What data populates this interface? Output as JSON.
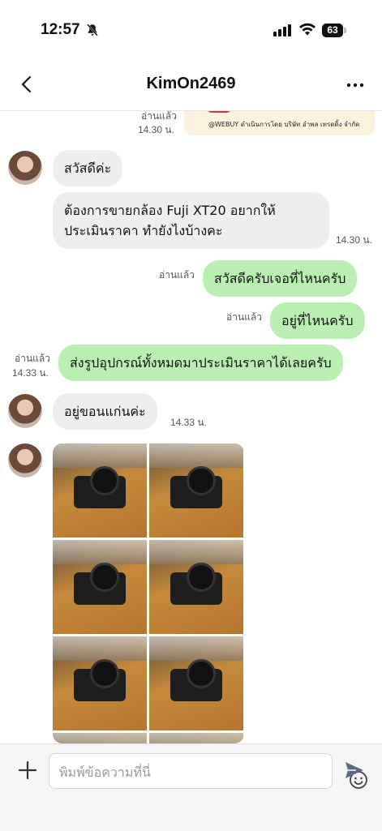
{
  "status_bar": {
    "time": "12:57",
    "battery": "63",
    "bell_icon": "bell-slash-icon",
    "signal_icon": "cellular-signal-icon",
    "wifi_icon": "wifi-icon"
  },
  "header": {
    "title": "KimOn2469",
    "back_icon": "chevron-left-icon",
    "more_icon": "more-horizontal-icon"
  },
  "messages": [
    {
      "kind": "image",
      "direction": "out",
      "read": "อ่านแล้ว",
      "time": "14.30 น.",
      "caption": "@WEBUY ดำเนินการโดย บริษัท อำพล เทรดดิ้ง จำกัด"
    },
    {
      "kind": "text",
      "direction": "in",
      "text": "สวัสดีค่ะ"
    },
    {
      "kind": "text",
      "direction": "in",
      "text_line1": "ต้องการขายกล้อง Fuji XT20 อยากให้",
      "text_line2": "ประเมินราคา ทำยังไงบ้างคะ",
      "time": "14.30 น."
    },
    {
      "kind": "text",
      "direction": "out",
      "read": "อ่านแล้ว",
      "text": "สวัสดีครับเจอที่ไหนครับ"
    },
    {
      "kind": "text",
      "direction": "out",
      "read": "อ่านแล้ว",
      "text": "อยู่ที่ไหนครับ"
    },
    {
      "kind": "text",
      "direction": "out",
      "read": "อ่านแล้ว",
      "time": "14.33 น.",
      "text": "ส่งรูปอุปกรณ์ทั้งหมดมาประเมินราคาได้เลยครับ"
    },
    {
      "kind": "text",
      "direction": "in",
      "text": "อยู่ขอนแก่นค่ะ",
      "time": "14.33 น."
    },
    {
      "kind": "photo_grid",
      "direction": "in",
      "photo_count_visible": 8
    }
  ],
  "composer": {
    "placeholder": "พิมพ์ข้อความที่นี่",
    "value": "",
    "plus_icon": "plus-icon",
    "emoji_icon": "smiley-icon",
    "send_icon": "send-icon"
  },
  "colors": {
    "outgoing_bubble": "#b9f0b1",
    "incoming_bubble": "#eeeeee",
    "background": "#ffffff"
  }
}
